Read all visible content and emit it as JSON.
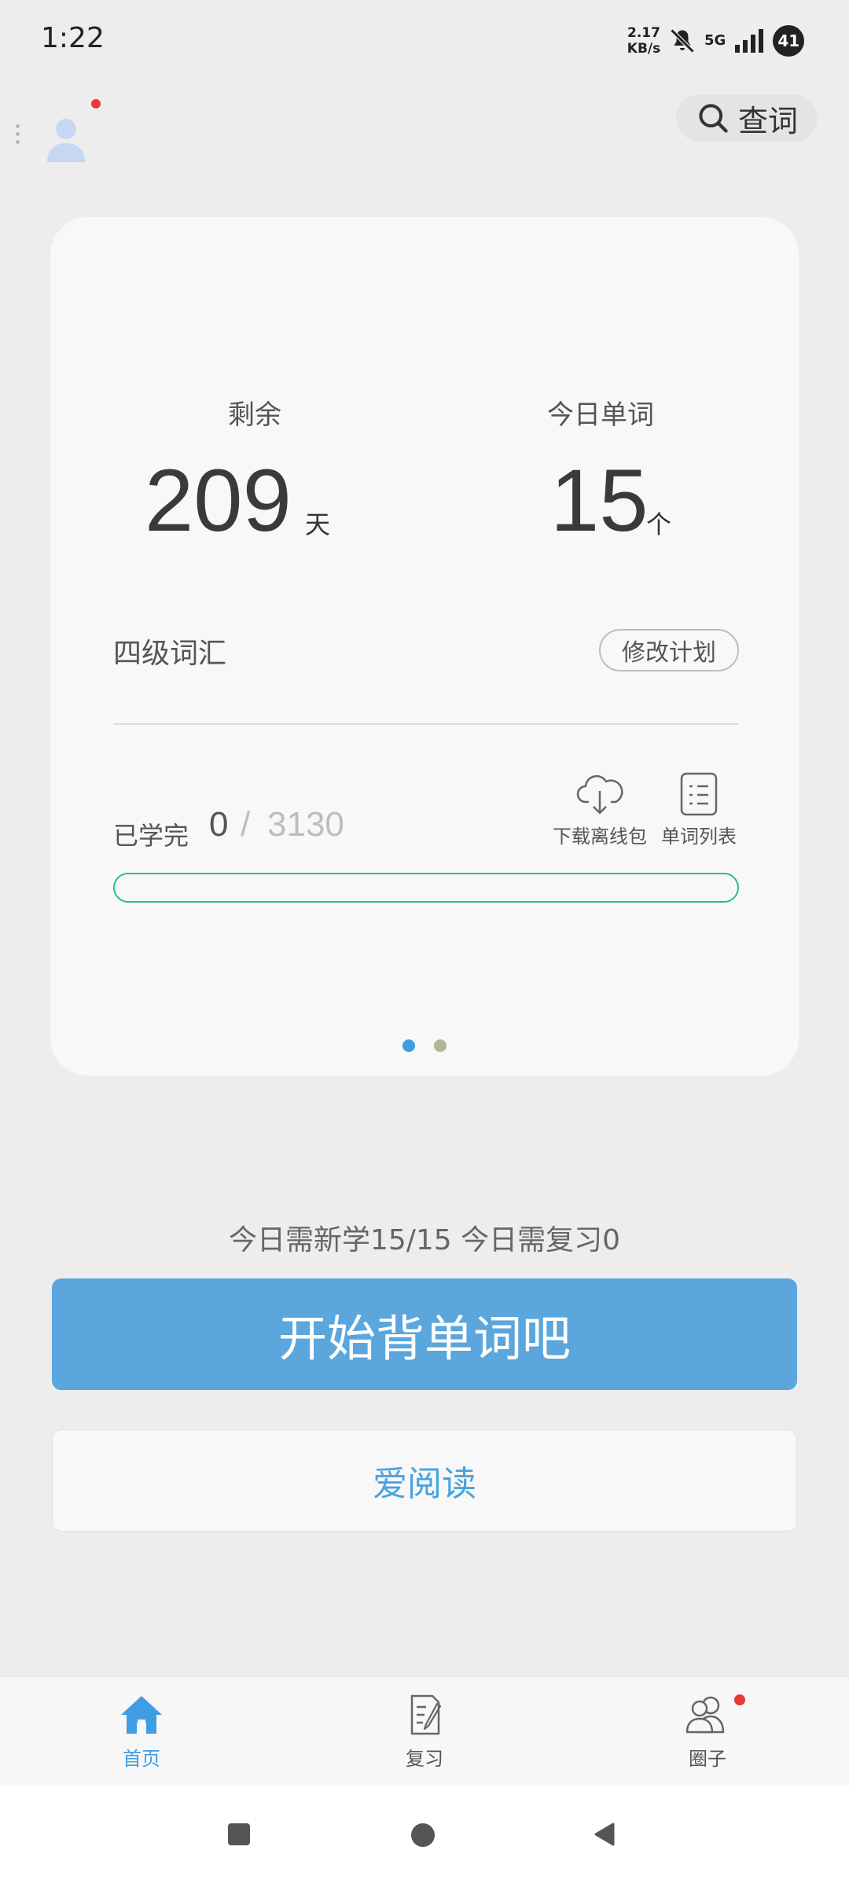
{
  "status_bar": {
    "time": "1:22",
    "net_speed_value": "2.17",
    "net_speed_unit": "KB/s",
    "network": "5G",
    "battery": "41"
  },
  "header": {
    "lookup_label": "查词"
  },
  "plan_card": {
    "remaining_label": "剩余",
    "remaining_value": "209",
    "remaining_unit": "天",
    "today_label": "今日单词",
    "today_value": "15",
    "today_unit": "个",
    "book_name": "四级词汇",
    "edit_plan_label": "修改计划",
    "learned_label": "已学完",
    "learned_count": "0",
    "learned_sep": "/",
    "learned_total": "3130",
    "download_label": "下载离线包",
    "wordlist_label": "单词列表",
    "progress_percent": 0
  },
  "daily_summary": "今日需新学15/15  今日需复习0",
  "start_button_label": "开始背单词吧",
  "read_button_label": "爱阅读",
  "tabs": [
    {
      "label": "首页",
      "icon": "home-icon",
      "active": true
    },
    {
      "label": "复习",
      "icon": "review-icon",
      "active": false
    },
    {
      "label": "圈子",
      "icon": "group-icon",
      "active": false
    }
  ],
  "colors": {
    "accent": "#5aa6dd",
    "active_tab": "#3f9de4",
    "progress": "#2fb89a",
    "badge": "#e53935"
  }
}
